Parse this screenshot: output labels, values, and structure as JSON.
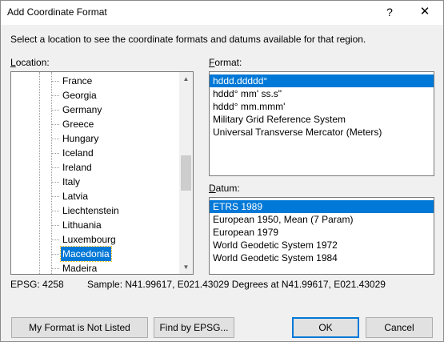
{
  "window": {
    "title": "Add Coordinate Format",
    "help_label": "?",
    "close_label": "✕"
  },
  "instruction": "Select a location to see the coordinate formats and datums available for that region.",
  "location": {
    "label": "Location:",
    "items": [
      {
        "label": "France",
        "selected": false
      },
      {
        "label": "Georgia",
        "selected": false
      },
      {
        "label": "Germany",
        "selected": false
      },
      {
        "label": "Greece",
        "selected": false
      },
      {
        "label": "Hungary",
        "selected": false
      },
      {
        "label": "Iceland",
        "selected": false
      },
      {
        "label": "Ireland",
        "selected": false
      },
      {
        "label": "Italy",
        "selected": false
      },
      {
        "label": "Latvia",
        "selected": false
      },
      {
        "label": "Liechtenstein",
        "selected": false
      },
      {
        "label": "Lithuania",
        "selected": false
      },
      {
        "label": "Luxembourg",
        "selected": false
      },
      {
        "label": "Macedonia",
        "selected": true
      },
      {
        "label": "Madeira",
        "selected": false
      }
    ]
  },
  "format": {
    "label": "Format:",
    "items": [
      {
        "label": "hddd.ddddd°",
        "selected": true
      },
      {
        "label": "hddd° mm' ss.s\"",
        "selected": false
      },
      {
        "label": "hddd° mm.mmm'",
        "selected": false
      },
      {
        "label": "Military Grid Reference System",
        "selected": false
      },
      {
        "label": "Universal Transverse Mercator (Meters)",
        "selected": false
      }
    ]
  },
  "datum": {
    "label": "Datum:",
    "items": [
      {
        "label": "ETRS 1989",
        "selected": true
      },
      {
        "label": "European 1950, Mean (7 Param)",
        "selected": false
      },
      {
        "label": "European 1979",
        "selected": false
      },
      {
        "label": "World Geodetic System 1972",
        "selected": false
      },
      {
        "label": "World Geodetic System 1984",
        "selected": false
      }
    ]
  },
  "status": {
    "epsg": "EPSG: 4258",
    "sample": "Sample: N41.99617, E021.43029 Degrees at N41.99617, E021.43029"
  },
  "buttons": {
    "not_listed": "My Format is Not Listed",
    "find_epsg": "Find by EPSG...",
    "ok": "OK",
    "cancel": "Cancel"
  },
  "icons": {
    "scroll_up": "▲",
    "scroll_down": "▼"
  }
}
